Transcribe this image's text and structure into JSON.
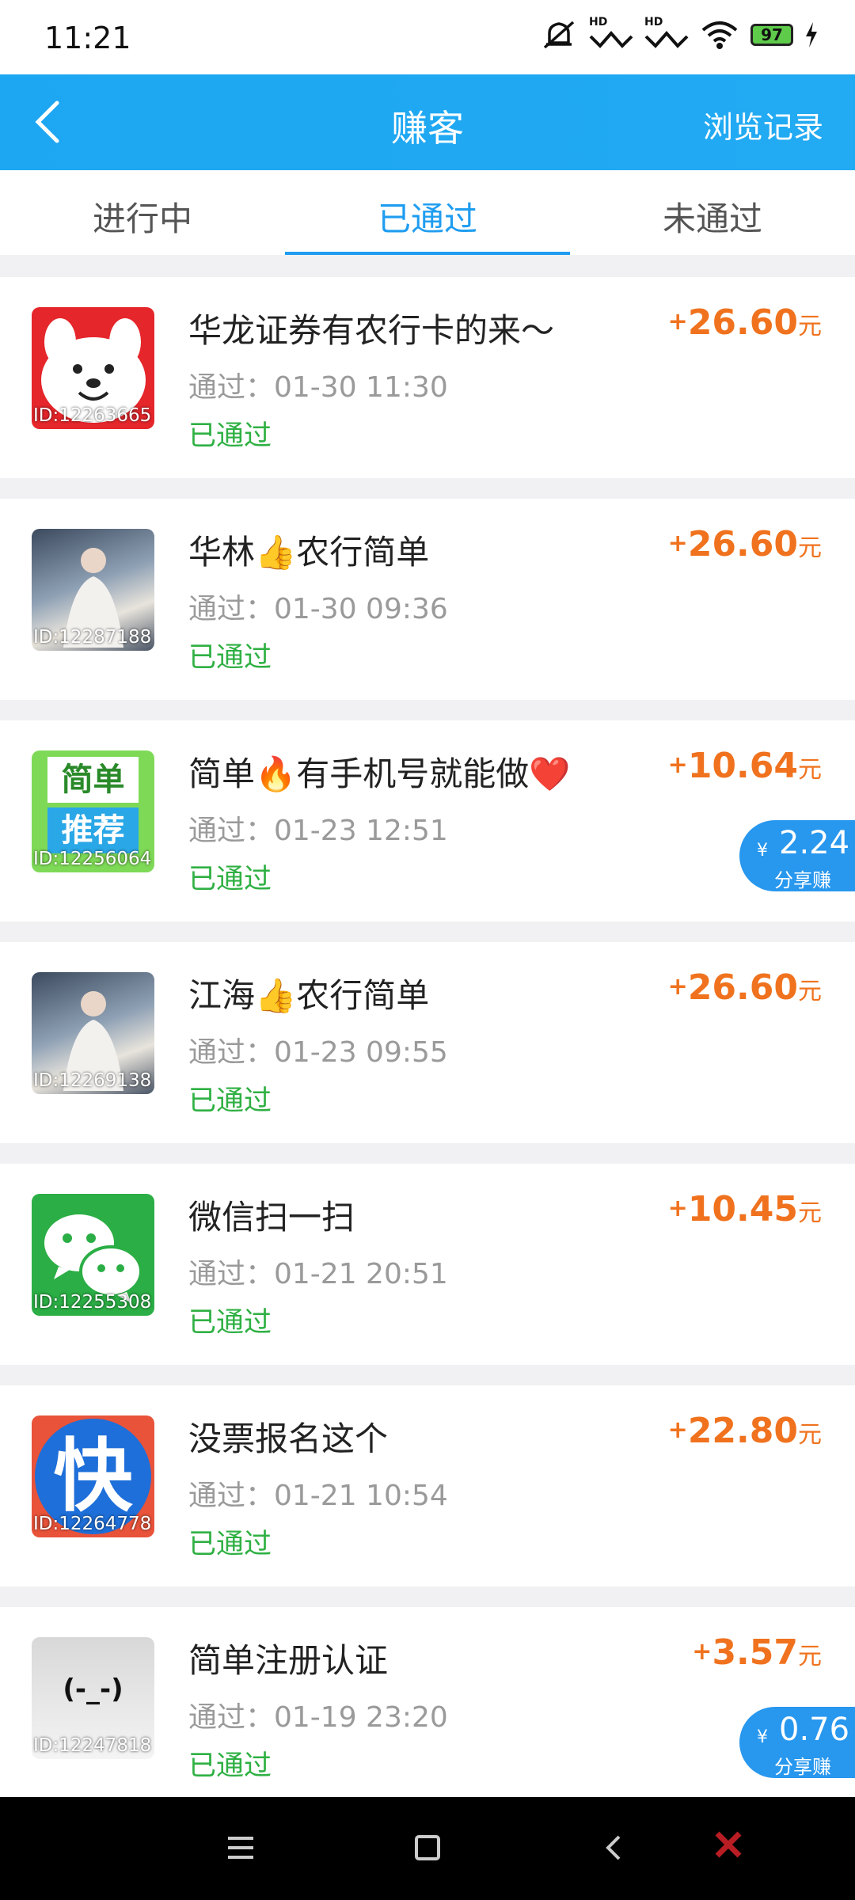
{
  "status_bar": {
    "time": "11:21",
    "battery": "97",
    "hd1": "HD",
    "hd2": "HD"
  },
  "app_bar": {
    "title": "赚客",
    "history_label": "浏览记录"
  },
  "tabs": [
    {
      "label": "进行中"
    },
    {
      "label": "已通过"
    },
    {
      "label": "未通过"
    }
  ],
  "colors": {
    "accent": "#1f9df0",
    "amount": "#f0721e",
    "passed": "#2fb043",
    "share_badge": "#2897ee"
  },
  "items": [
    {
      "thumb_icon": "jd-dog-mascot-icon",
      "id_label": "ID:12263665",
      "name": "华龙证券有农行卡的来～",
      "time": "通过：01-30 11:30",
      "status": "已通过",
      "plus": "+",
      "amount": "26.60",
      "unit": "元"
    },
    {
      "thumb_icon": "portrait-photo-icon",
      "id_label": "ID:12287188",
      "name": "华林👍农行简单",
      "time": "通过：01-30 09:36",
      "status": "已通过",
      "plus": "+",
      "amount": "26.60",
      "unit": "元"
    },
    {
      "thumb_icon": "simple-recommend-icon",
      "thumb_text_top": "简单",
      "thumb_text_bottom": "推荐",
      "id_label": "ID:12256064",
      "name": "简单🔥有手机号就能做❤️",
      "time": "通过：01-23 12:51",
      "status": "已通过",
      "plus": "+",
      "amount": "10.64",
      "unit": "元",
      "share": {
        "yen": "¥",
        "value": "2.24",
        "label": "分享赚"
      }
    },
    {
      "thumb_icon": "portrait-photo-icon",
      "id_label": "ID:12269138",
      "name": "江海👍农行简单",
      "time": "通过：01-23 09:55",
      "status": "已通过",
      "plus": "+",
      "amount": "26.60",
      "unit": "元"
    },
    {
      "thumb_icon": "wechat-icon",
      "id_label": "ID:12255308",
      "name": "微信扫一扫",
      "time": "通过：01-21 20:51",
      "status": "已通过",
      "plus": "+",
      "amount": "10.45",
      "unit": "元"
    },
    {
      "thumb_icon": "kuaishou-icon",
      "thumb_text": "快",
      "id_label": "ID:12264778",
      "name": "没票报名这个",
      "time": "通过：01-21 10:54",
      "status": "已通过",
      "plus": "+",
      "amount": "22.80",
      "unit": "元"
    },
    {
      "thumb_icon": "face-emoticon-icon",
      "thumb_text": "(-_-)",
      "id_label": "ID:12247818",
      "name": "简单注册认证",
      "time": "通过：01-19 23:20",
      "status": "已通过",
      "plus": "+",
      "amount": "3.57",
      "unit": "元",
      "share": {
        "yen": "¥",
        "value": "0.76",
        "label": "分享赚"
      }
    }
  ]
}
